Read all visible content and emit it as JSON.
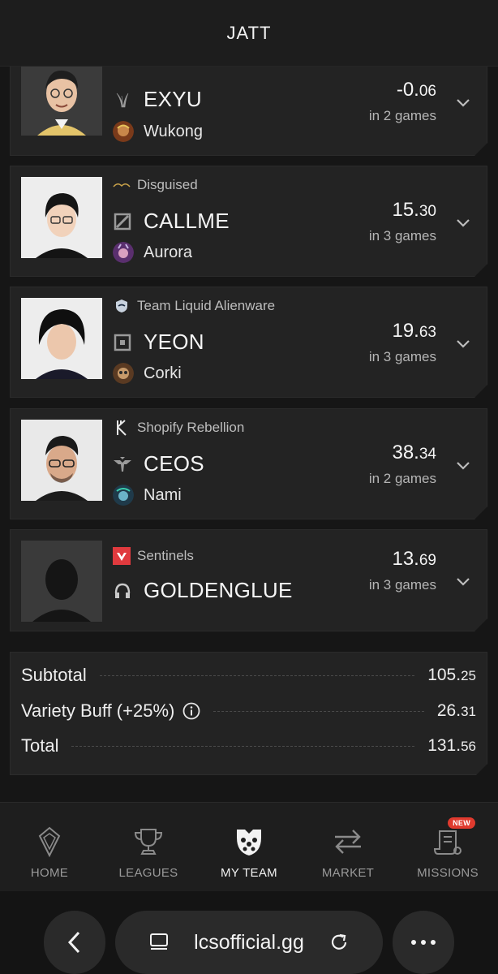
{
  "header": {
    "title": "JATT"
  },
  "players": [
    {
      "team": "",
      "name": "EXYU",
      "champion": "Wukong",
      "score_int": "-0.",
      "score_dec": "06",
      "games": "in 2 games",
      "role": "jungle"
    },
    {
      "team": "Disguised",
      "name": "CALLME",
      "champion": "Aurora",
      "score_int": "15.",
      "score_dec": "30",
      "games": "in 3 games",
      "role": "mid"
    },
    {
      "team": "Team Liquid Alienware",
      "name": "YEON",
      "champion": "Corki",
      "score_int": "19.",
      "score_dec": "63",
      "games": "in 3 games",
      "role": "bot"
    },
    {
      "team": "Shopify Rebellion",
      "name": "CEOS",
      "champion": "Nami",
      "score_int": "38.",
      "score_dec": "34",
      "games": "in 2 games",
      "role": "support"
    },
    {
      "team": "Sentinels",
      "name": "GOLDENGLUE",
      "champion": "",
      "score_int": "13.",
      "score_dec": "69",
      "games": "in 3 games",
      "role": "coach"
    }
  ],
  "totals": {
    "subtotal_label": "Subtotal",
    "subtotal_int": "105.",
    "subtotal_dec": "25",
    "buff_label": "Variety Buff (+25%)",
    "buff_int": "26.",
    "buff_dec": "31",
    "total_label": "Total",
    "total_int": "131.",
    "total_dec": "56"
  },
  "nav": {
    "home": "HOME",
    "leagues": "LEAGUES",
    "my_team": "MY TEAM",
    "market": "MARKET",
    "missions": "MISSIONS",
    "missions_badge": "NEW"
  },
  "browser": {
    "url": "lcsofficial.gg"
  },
  "colors": {
    "background": "#161616",
    "card": "#232323",
    "sentinels": "#e03a3e",
    "badge": "#e03a2e"
  }
}
